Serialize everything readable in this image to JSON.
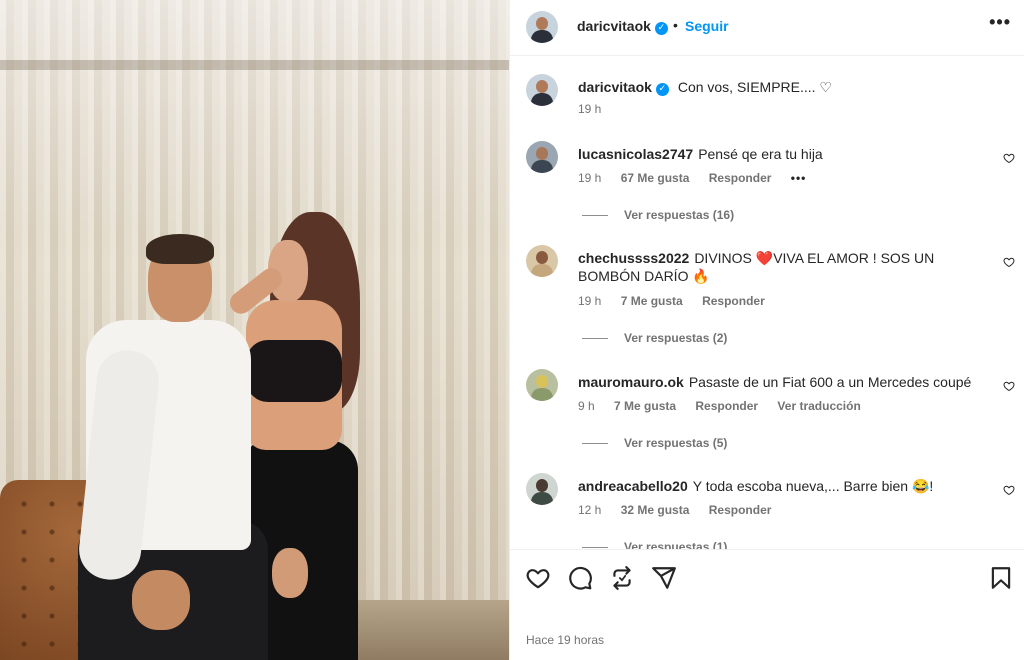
{
  "post": {
    "username": "daricvitaok",
    "follow_label": "Seguir",
    "dot": "•",
    "more_label": "•••",
    "caption": "Con vos, SIEMPRE.... ♡",
    "caption_time": "19 h",
    "posted_ago": "Hace 19 horas"
  },
  "comments": [
    {
      "username": "lucasnicolas2747",
      "text": "Pensé qe era tu hija",
      "time": "19 h",
      "likes": "67 Me gusta",
      "reply_label": "Responder",
      "more": "•••",
      "replies": "Ver respuestas (16)"
    },
    {
      "username": "chechussss2022",
      "text": "DIVINOS ❤️VIVA EL AMOR ! SOS UN BOMBÓN DARÍO 🔥",
      "time": "19 h",
      "likes": "7 Me gusta",
      "reply_label": "Responder",
      "replies": "Ver respuestas (2)"
    },
    {
      "username": "mauromauro.ok",
      "text": "Pasaste de un Fiat 600 a un Mercedes coupé",
      "time": "9 h",
      "likes": "7 Me gusta",
      "reply_label": "Responder",
      "translate_label": "Ver traducción",
      "replies": "Ver respuestas (5)"
    },
    {
      "username": "andreacabello20",
      "text": "Y toda escoba nueva,... Barre bien 😂!",
      "time": "12 h",
      "likes": "32 Me gusta",
      "reply_label": "Responder",
      "replies": "Ver respuestas (1)"
    }
  ],
  "icons": {
    "like": "heart-icon",
    "comment": "comment-icon",
    "repost": "repost-icon",
    "share": "share-icon",
    "save": "bookmark-icon",
    "verified": "verified-badge-icon"
  },
  "colors": {
    "accent": "#0095f6",
    "text": "#262626",
    "secondary": "#737373"
  }
}
